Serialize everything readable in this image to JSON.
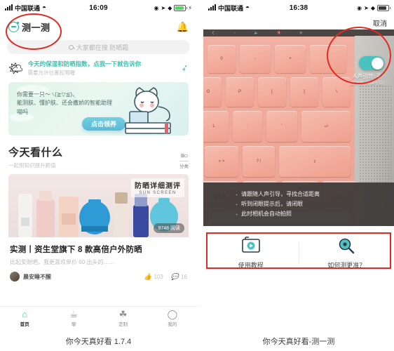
{
  "left_phone": {
    "status_bar": {
      "carrier": "中国联通",
      "time": "16:09",
      "wifi_icon": "wifi-icon",
      "signal_icon": "signal-bars-icon",
      "location_icon": "location-icon",
      "bluetooth_icon": "bluetooth-icon",
      "battery_icon": "battery-charging-icon",
      "charging_icon": "lightning-bolt-icon",
      "battery_color": "#4cd964"
    },
    "header": {
      "brand_icon": "scan-face-icon",
      "brand_title": "测一测",
      "bell_icon": "bell-icon"
    },
    "search": {
      "icon": "search-icon",
      "placeholder": "大家都在搜 防晒霜"
    },
    "weather_tip": {
      "icon": "sun-cloud-icon",
      "main": "今天的保湿和防晒指数，点我一下就告诉你",
      "sub": "需要允许位置权限喔",
      "cursor_icon": "tap-cursor-icon"
    },
    "promo_card": {
      "line1": "你需要一只～ ৻(≧▽≦)৲",
      "line2": "能测肤、懂护肤、还会撒娇的智能助理",
      "line3": "喵吗",
      "button_label": "点击领养",
      "cat_icon": "cat-mascot-icon"
    },
    "section": {
      "title": "今天看什么",
      "subtitle": "一起用知识提升颜值",
      "filter_icon": "sort-filter-icon",
      "filter_label": "分类"
    },
    "article": {
      "badge_title": "防晒详细测评",
      "badge_subtitle": "SUN SCREEN",
      "read_count": "9748 阅读",
      "title": "实测丨资生堂旗下 8 款高倍户外防晒",
      "desc": "比起安耐晒，我更喜欢单价 60 出头的……",
      "author": "晨安睡不醒",
      "avatar_icon": "avatar-icon",
      "like_icon": "thumbs-up-icon",
      "likes": "103",
      "comment_icon": "comment-icon",
      "comments": "16"
    },
    "tabbar": [
      {
        "icon": "home-icon",
        "label": "首页",
        "active": true
      },
      {
        "icon": "cup-icon",
        "label": "聊",
        "active": false
      },
      {
        "icon": "custom-icon",
        "label": "定制",
        "active": false
      },
      {
        "icon": "person-icon",
        "label": "我的",
        "active": false
      }
    ],
    "caption": "你今天真好看 1.7.4"
  },
  "right_phone": {
    "status_bar": {
      "carrier": "中国联通",
      "time": "16:38",
      "wifi_icon": "wifi-icon",
      "signal_icon": "signal-bars-icon",
      "location_icon": "location-icon",
      "bluetooth_icon": "bluetooth-icon",
      "battery_icon": "battery-icon",
      "battery_color": "#3a3a3a"
    },
    "top_bar": {
      "cancel_label": "取消"
    },
    "voice_toggle": {
      "state": "on",
      "label": "人声引导: 开",
      "sub_label": "(提示音+人声引导)",
      "accent_color": "#49c3bf"
    },
    "instructions": [
      "请跟随人声引导，寻找合适距离",
      "听到闭眼提示后，请闭眼",
      "此时相机会自动拍照"
    ],
    "actions": [
      {
        "icon": "tutorial-video-icon",
        "label": "使用教程"
      },
      {
        "icon": "magnifier-eye-icon",
        "label": "如何测更准？"
      }
    ],
    "caption": "你今天真好看-测一测"
  },
  "highlight_color": "#e02b25"
}
